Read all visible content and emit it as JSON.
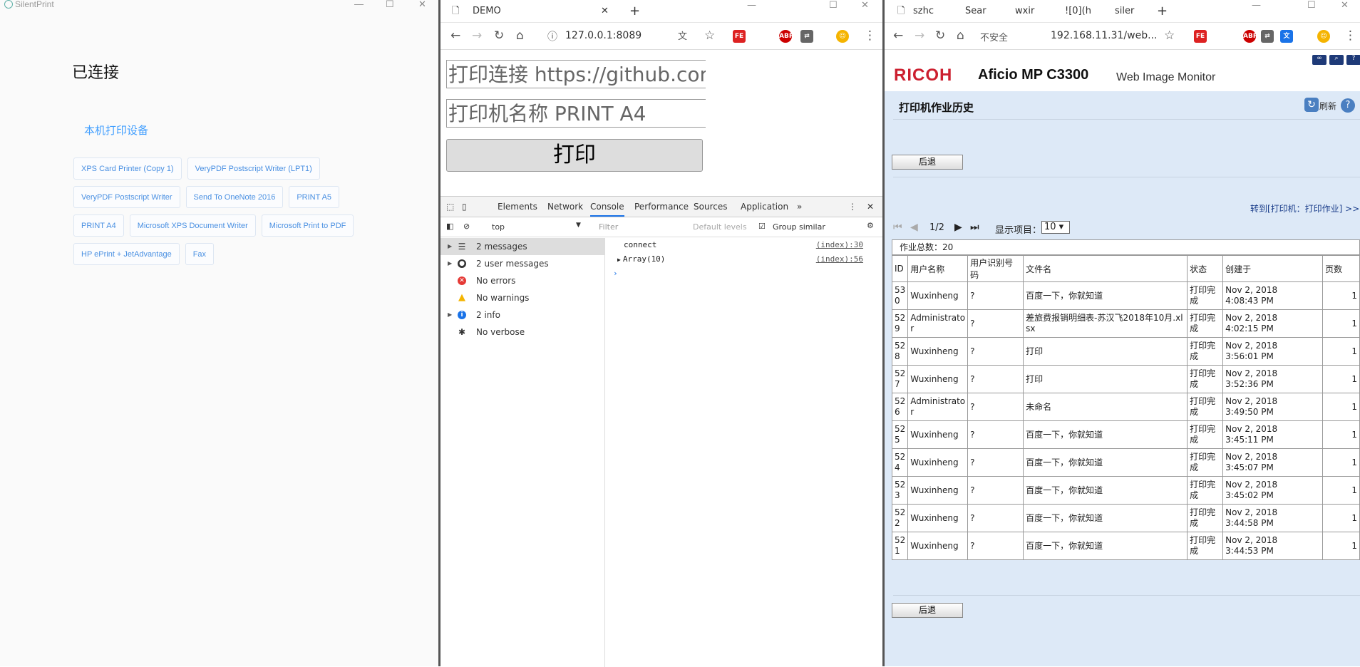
{
  "silentprint": {
    "app_title": "SilentPrint",
    "status": "已连接",
    "devices_title": "本机打印设备",
    "devices": [
      "XPS Card Printer (Copy 1)",
      "VeryPDF Postscript Writer (LPT1)",
      "VeryPDF Postscript Writer",
      "Send To OneNote 2016",
      "PRINT A5",
      "PRINT A4",
      "Microsoft XPS Document Writer",
      "Microsoft Print to PDF",
      "HP ePrint + JetAdvantage",
      "Fax"
    ]
  },
  "demo": {
    "tab_title": "DEMO",
    "url": "127.0.0.1:8089",
    "link_input": "打印连接 https://github.com/",
    "printer_input": "打印机名称 PRINT A4",
    "print_button": "打印",
    "devtools": {
      "tabs": [
        "Elements",
        "Network",
        "Console",
        "Performance",
        "Sources",
        "Application"
      ],
      "active_tab": "Console",
      "context": "top",
      "filter_placeholder": "Filter",
      "levels": "Default levels",
      "group_similar": "Group similar",
      "sidebar": [
        "2 messages",
        "2 user messages",
        "No errors",
        "No warnings",
        "2 info",
        "No verbose"
      ],
      "console": [
        {
          "text": "connect",
          "src": "(index):30"
        },
        {
          "text": "Array(10)",
          "src": "(index):56"
        }
      ]
    }
  },
  "ricoh": {
    "tabs": [
      "szhc",
      "Sear",
      "wxir",
      "![0](h",
      "siler"
    ],
    "security": "不安全",
    "url": "192.168.11.31/web...",
    "brand": "RICOH",
    "model": "Aficio MP C3300",
    "product": "Web Image Monitor",
    "page_title": "打印机作业历史",
    "refresh": "刷新",
    "back": "后退",
    "goto_link": "转到[打印机：打印作业] >>",
    "pager": "1/2",
    "display_label": "显示项目：",
    "display_value": "10",
    "total": "作业总数：20",
    "headers": [
      "ID",
      "用户名称",
      "用户识别号码",
      "文件名",
      "状态",
      "创建于",
      "页数"
    ],
    "rows": [
      [
        "53\n0",
        "Wuxinheng",
        "?",
        "百度一下，你就知道",
        "打印完\n成",
        "Nov 2, 2018\n4:08:43 PM",
        "1"
      ],
      [
        "52\n9",
        "Administrato\nr",
        "?",
        "差旅费报销明细表-苏汉飞2018年10月.xl\nsx",
        "打印完\n成",
        "Nov 2, 2018\n4:02:15 PM",
        "1"
      ],
      [
        "52\n8",
        "Wuxinheng",
        "?",
        "打印",
        "打印完\n成",
        "Nov 2, 2018\n3:56:01 PM",
        "1"
      ],
      [
        "52\n7",
        "Wuxinheng",
        "?",
        "打印",
        "打印完\n成",
        "Nov 2, 2018\n3:52:36 PM",
        "1"
      ],
      [
        "52\n6",
        "Administrato\nr",
        "?",
        "未命名",
        "打印完\n成",
        "Nov 2, 2018\n3:49:50 PM",
        "1"
      ],
      [
        "52\n5",
        "Wuxinheng",
        "?",
        "百度一下，你就知道",
        "打印完\n成",
        "Nov 2, 2018\n3:45:11 PM",
        "1"
      ],
      [
        "52\n4",
        "Wuxinheng",
        "?",
        "百度一下，你就知道",
        "打印完\n成",
        "Nov 2, 2018\n3:45:07 PM",
        "1"
      ],
      [
        "52\n3",
        "Wuxinheng",
        "?",
        "百度一下，你就知道",
        "打印完\n成",
        "Nov 2, 2018\n3:45:02 PM",
        "1"
      ],
      [
        "52\n2",
        "Wuxinheng",
        "?",
        "百度一下，你就知道",
        "打印完\n成",
        "Nov 2, 2018\n3:44:58 PM",
        "1"
      ],
      [
        "52\n1",
        "Wuxinheng",
        "?",
        "百度一下，你就知道",
        "打印完\n成",
        "Nov 2, 2018\n3:44:53 PM",
        "1"
      ]
    ]
  }
}
